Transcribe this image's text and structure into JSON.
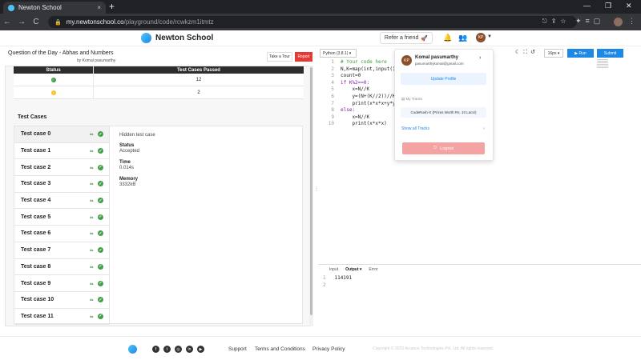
{
  "browser": {
    "tab_title": "Newton School",
    "tab_close": "×",
    "new_tab": "+",
    "win_min": "—",
    "win_max": "❐",
    "win_close": "✕",
    "back": "←",
    "forward": "→",
    "reload": "C",
    "url_host": "my.newtonschool.co",
    "url_path": "/playground/code/rcwkzm1itmtz"
  },
  "header": {
    "brand": "Newton School",
    "refer_label": "Refer a friend",
    "avatar_initials": "KP"
  },
  "question": {
    "title": "Question of the Day - Abhas and Numbers",
    "author": "by Komal pasumarthy",
    "tour_label": "Take a Tour",
    "report_label": "Report"
  },
  "summary": {
    "headers": [
      "Status",
      "Test Cases Passed"
    ],
    "rows": [
      {
        "count": "12"
      },
      {
        "count": "2"
      }
    ]
  },
  "testcases": {
    "title": "Test Cases",
    "ms_label": "4s",
    "items": [
      "Test case 0",
      "Test case 1",
      "Test case 2",
      "Test case 3",
      "Test case 4",
      "Test case 5",
      "Test case 6",
      "Test case 7",
      "Test case 8",
      "Test case 9",
      "Test case 10",
      "Test case 11"
    ],
    "detail": {
      "hidden": "Hidden test case",
      "status_label": "Status",
      "status_value": "Accepted",
      "time_label": "Time",
      "time_value": "0.014s",
      "memory_label": "Memory",
      "memory_value": "3332kB"
    }
  },
  "editor": {
    "language": "Python (3.8.1) ▾",
    "font_size": "16px ▾",
    "run_label": "▶ Run",
    "submit_label": "Submit",
    "lines": [
      {
        "n": "1",
        "text": "# Your code here",
        "kind": "comment"
      },
      {
        "n": "2",
        "text": "N,K=map(int,input()",
        "kind": "code"
      },
      {
        "n": "3",
        "text": "count=0",
        "kind": "code"
      },
      {
        "n": "4",
        "text": "if K%2==0:",
        "kind": "code"
      },
      {
        "n": "5",
        "text": "    x=N//K",
        "kind": "code"
      },
      {
        "n": "6",
        "text": "    y=(N+(K//2))//K",
        "kind": "code"
      },
      {
        "n": "7",
        "text": "    print(x*x*x+y*y",
        "kind": "code"
      },
      {
        "n": "8",
        "text": "else:",
        "kind": "code"
      },
      {
        "n": "9",
        "text": "    x=N//K",
        "kind": "code"
      },
      {
        "n": "10",
        "text": "    print(x*x*x)",
        "kind": "code"
      }
    ]
  },
  "output": {
    "tabs": [
      "Input",
      "Output ▾",
      "Error"
    ],
    "lines": [
      {
        "n": "1",
        "text": "114191"
      },
      {
        "n": "2",
        "text": ""
      }
    ]
  },
  "profile_menu": {
    "initials": "KP",
    "name": "Komal pasumarthy",
    "email": "pasumarthykomal@gmail.com",
    "update_label": "Update Profile",
    "tracks_label": "My Tracks",
    "track": "CodeRush-X (Prizes Worth Rs. 10 Lacs!)",
    "show_all": "Show all Tracks",
    "logout": "Logout"
  },
  "footer": {
    "links": [
      "Support",
      "Terms and Conditions",
      "Privacy Policy"
    ],
    "copyright": "Copyright © 2023 Arcanus Technologies Pvt. Ltd. All rights reserved."
  },
  "colors": {
    "accent": "#1e88e5",
    "success": "#43a047",
    "warning": "#fbc02d",
    "danger": "#e53935"
  }
}
